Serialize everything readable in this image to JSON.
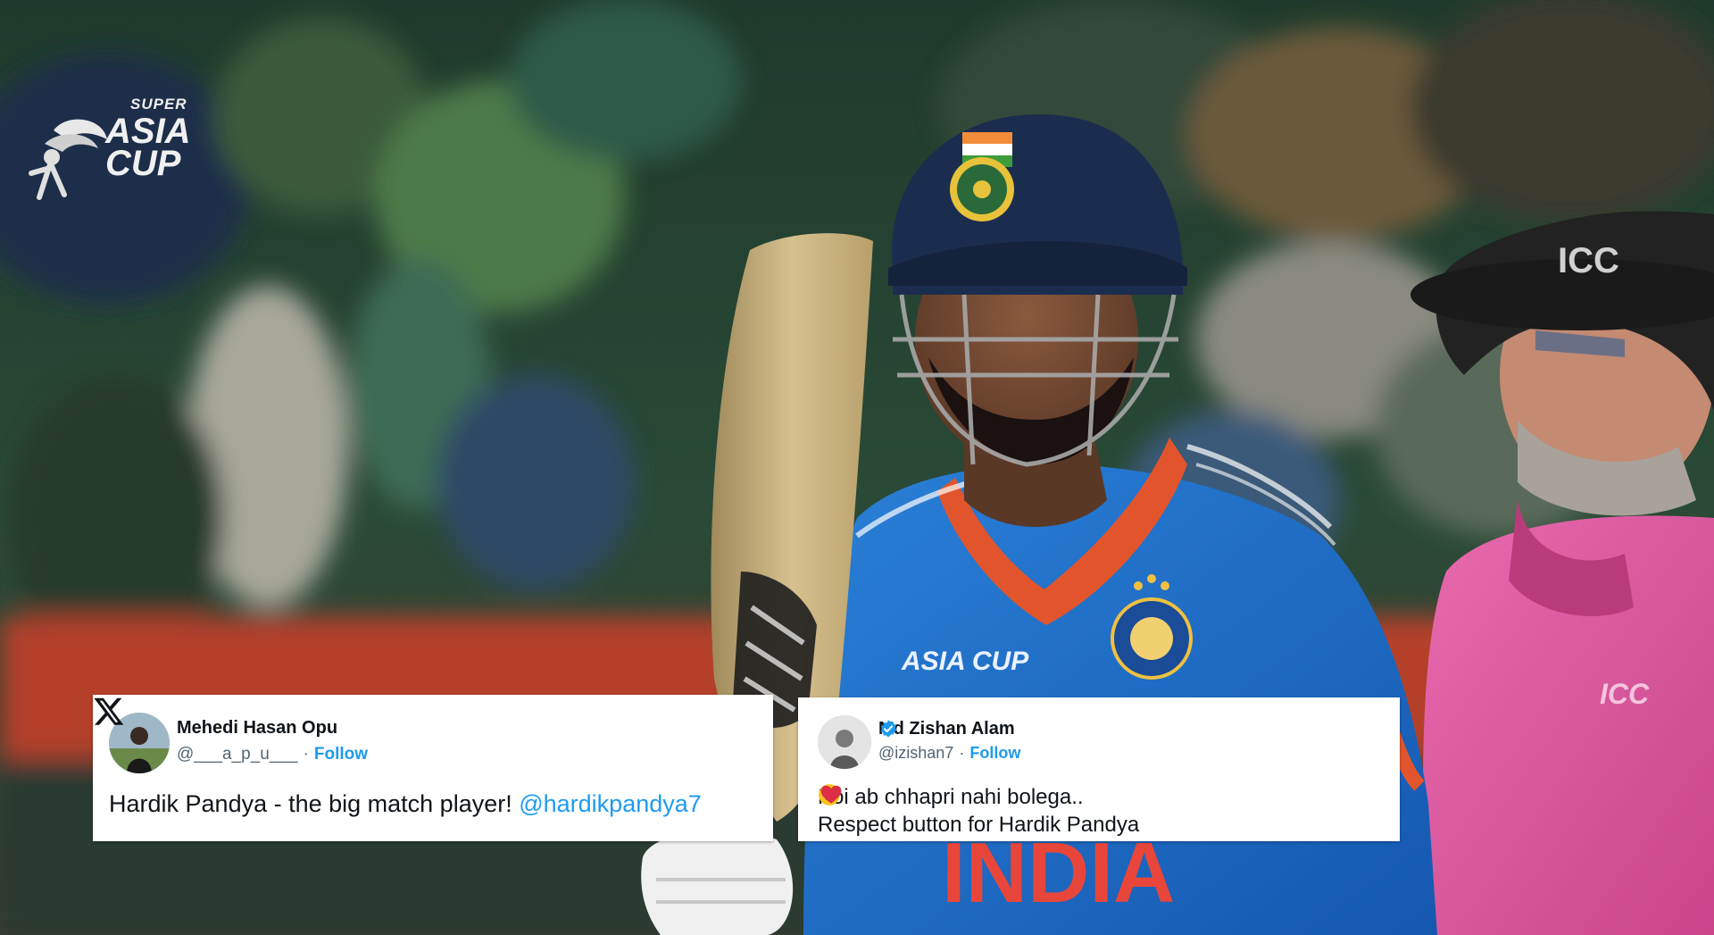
{
  "logo": {
    "super": "SUPER",
    "asia": "ASIA",
    "cup": "CUP"
  },
  "player": {
    "jersey_text": "INDIA",
    "jersey_logo": "ASIA CUP"
  },
  "umpire": {
    "hat_text": "ICC",
    "shirt_text": "ICC"
  },
  "tweets": [
    {
      "name": "Mehedi Hasan Opu",
      "handle": "@___a_p_u___",
      "separator": "·",
      "follow": "Follow",
      "text": "Hardik Pandya - the big match player! ",
      "mention": "@hardikpandya7",
      "platform_icon": "x-logo-icon"
    },
    {
      "name": "Md Zishan Alam",
      "handle": "@izishan7",
      "separator": "·",
      "follow": "Follow",
      "text_line1": "Koi ab chhapri nahi bolega..",
      "text_line2": "Respect button for Hardik Pandya",
      "verified_icon": "verified-badge-icon",
      "emojis": [
        "relieved-face-icon",
        "red-heart-icon"
      ]
    }
  ],
  "colors": {
    "jersey_blue": "#1f6fc8",
    "umpire_pink": "#e0559f",
    "helmet_navy": "#1b2d4f",
    "twitter_blue": "#1d9bf0"
  }
}
